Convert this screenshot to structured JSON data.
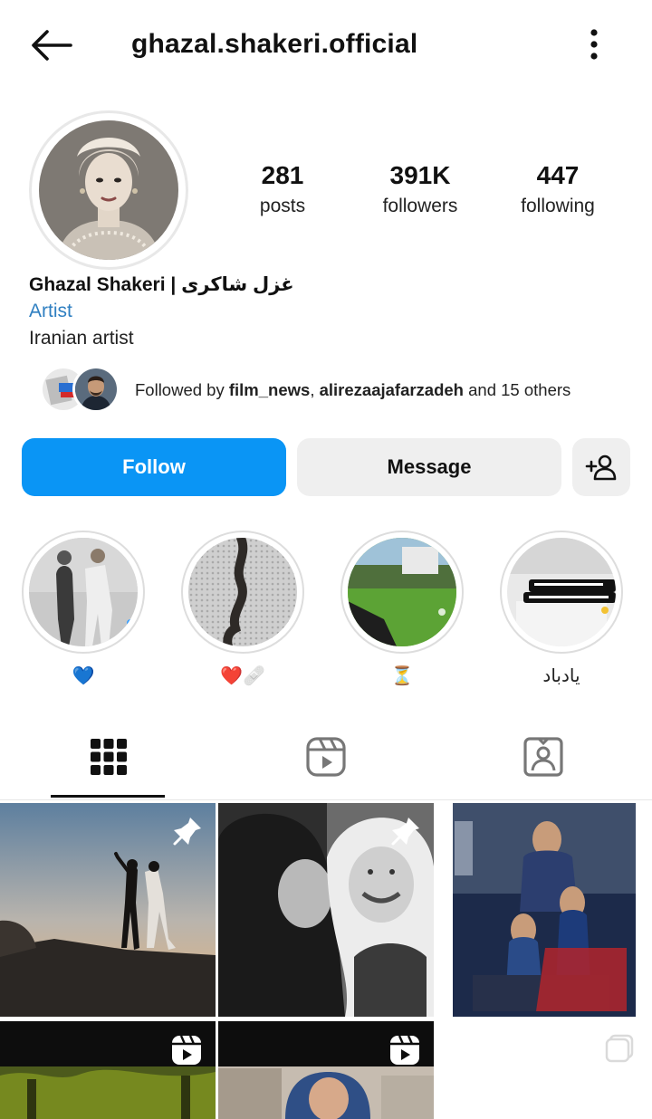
{
  "header": {
    "username": "ghazal.shakeri.official",
    "back_icon": "arrow-left-icon",
    "more_icon": "more-vertical-icon"
  },
  "profile": {
    "posts_count": "281",
    "posts_label": "posts",
    "followers_count": "391K",
    "followers_label": "followers",
    "following_count": "447",
    "following_label": "following",
    "display_name": "Ghazal Shakeri | غزل شاکری",
    "category": "Artist",
    "bio": "Iranian artist"
  },
  "followed_by": {
    "prefix": "Followed by ",
    "user1": "film_news",
    "separator": ", ",
    "user2": "alirezaajafarzadeh",
    "suffix": " and 15 others"
  },
  "actions": {
    "follow_label": "Follow",
    "message_label": "Message",
    "add_person_icon": "add-person-icon"
  },
  "highlights": [
    {
      "label": "💙"
    },
    {
      "label": "❤️🩹"
    },
    {
      "label": "⏳"
    },
    {
      "label": "یادباد"
    }
  ],
  "tabs": [
    {
      "name": "grid",
      "icon": "grid-icon",
      "active": true
    },
    {
      "name": "reels",
      "icon": "reels-icon",
      "active": false
    },
    {
      "name": "tagged",
      "icon": "tagged-icon",
      "active": false
    }
  ],
  "colors": {
    "accent": "#0a95f5",
    "category_link": "#2f7fc1",
    "button_gray": "#efefef"
  }
}
